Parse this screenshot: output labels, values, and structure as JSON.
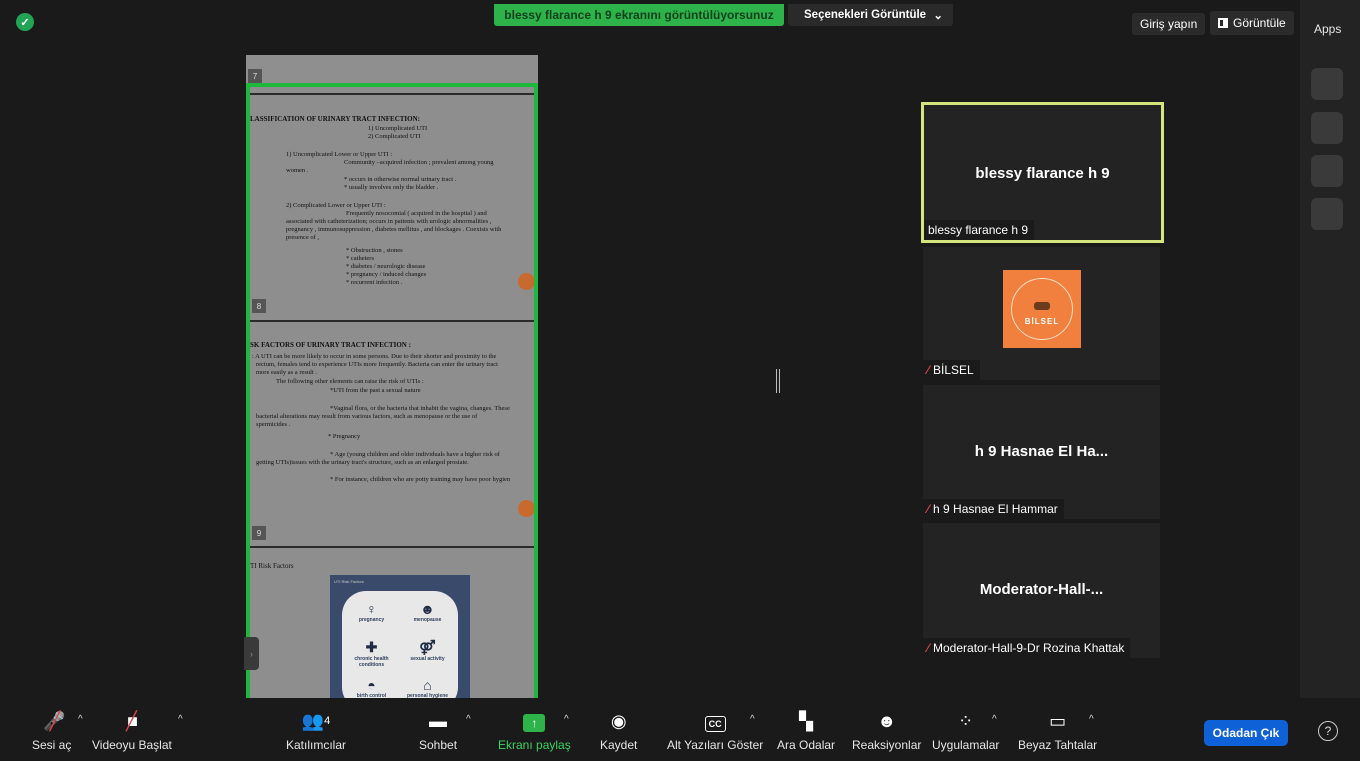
{
  "header": {
    "share_banner": "blessy flarance h 9 ekranını görüntülüyorsunuz",
    "options_label": "Seçenekleri Görüntüle",
    "options_caret": "⌄",
    "login_label": "Giriş yapın",
    "view_label": "Görüntüle"
  },
  "apps": {
    "label": "Apps"
  },
  "document": {
    "page_numbers": [
      "7",
      "8",
      "9"
    ],
    "section1": {
      "title": "LASSIFICATION OF URINARY TRACT INFECTION:",
      "lines": [
        "1) Uncomplicated  UTI",
        "2) Complicated UTI",
        "1) Uncomplicated Lower or Upper  UTI :",
        "Community –acquired infection ; prevalent among young",
        "women .",
        "* occurs in otherwise normal urinary tract .",
        "* usually involves only the bladder .",
        "2) Complicated Lower or Upper UTI :",
        "Frequently nosocomial ( acquired in the hospital ) and",
        "associated with catheterization; occurs in patients with urologic abnormalities ,",
        "pregnancy , immunosuppression , diabetes mellitus , and blockages . Coexists with",
        "presence of ,",
        "* Obstruction , stones",
        "* catheters",
        "* diabetes / neurologic disease",
        "* pregnancy / induced changes",
        "* recurrent infection ."
      ]
    },
    "section2": {
      "title": "SK FACTORS OF URINARY TRACT INFECTION :",
      "lines": [
        ": A UTI can be more likely to occur in some persons. Due to their shorter and proximity to the",
        "rectum, females tend to experience UTIs more frequently. Bacteria can enter the urinary tract",
        "more easily as a result .",
        "The following other elements can raise the risk of UTIs :",
        "*UTI from the past a sexual nature",
        "*Vaginal flora, or the bacteria that inhabit the vagina, changes. These",
        "bacterial alterations may result from various factors, such as menopause or the use of",
        "spermicides .",
        "* Pregnancy",
        "* Age (young children and older individuals have a higher risk of",
        "getting UTIs)issues with the urinary tract's structure, such as an enlarged prostate.",
        "* For instance, children who are potty training may have poor hygien"
      ]
    },
    "section3": {
      "title": "TI Risk Factors",
      "infographic_title": "UTI Risk Factors",
      "items": [
        "pregnancy",
        "menopause",
        "chronic health conditions",
        "sexual activity",
        "birth control",
        "personal hygiene"
      ]
    }
  },
  "participants": [
    {
      "display": "blessy flarance h 9",
      "label": "blessy flarance h 9",
      "muted": false,
      "active": true
    },
    {
      "display": "",
      "label": "BİLSEL",
      "muted": true,
      "avatar_text": "BİLSEL"
    },
    {
      "display": "h 9 Hasnae El Ha...",
      "label": "h 9 Hasnae El Hammar",
      "muted": true
    },
    {
      "display": "Moderator-Hall-...",
      "label": "Moderator-Hall-9-Dr Rozina Khattak",
      "muted": true
    }
  ],
  "toolbar": {
    "unmute": "Sesi aç",
    "start_video": "Videoyu Başlat",
    "participants": "Katılımcılar",
    "participant_count": "4",
    "chat": "Sohbet",
    "share_screen": "Ekranı paylaş",
    "record": "Kaydet",
    "captions": "Alt Yazıları Göster",
    "cc_glyph": "CC",
    "breakout": "Ara Odalar",
    "reactions": "Reaksiyonlar",
    "apps": "Uygulamalar",
    "whiteboards": "Beyaz Tahtalar",
    "leave": "Odadan Çık",
    "help": "?"
  },
  "colors": {
    "share_green": "#2db34a",
    "active_speaker": "#d4e57c",
    "leave_blue": "#0e61d6",
    "muted_red": "#e04444"
  }
}
